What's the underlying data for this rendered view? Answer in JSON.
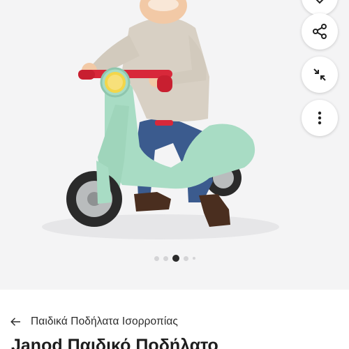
{
  "product": {
    "image_alt": "Mint green child balance bike scooter with toddler",
    "gallery_dots": {
      "count": 5,
      "active_index": 2
    }
  },
  "actions": [
    {
      "name": "favorite-button",
      "icon": "heart-icon"
    },
    {
      "name": "share-button",
      "icon": "share-icon"
    },
    {
      "name": "collapse-button",
      "icon": "collapse-arrows-icon"
    },
    {
      "name": "more-options-button",
      "icon": "more-vertical-icon"
    }
  ],
  "breadcrumb": {
    "back_icon": "arrow-left-icon",
    "label": "Παιδικά Ποδήλατα Ισορροπίας"
  },
  "title": "Janod Παιδικό Ποδήλατο",
  "colors": {
    "scooter_body": "#a8dcc4",
    "handle_grips": "#d8283a",
    "background": "#f4f4f5"
  }
}
